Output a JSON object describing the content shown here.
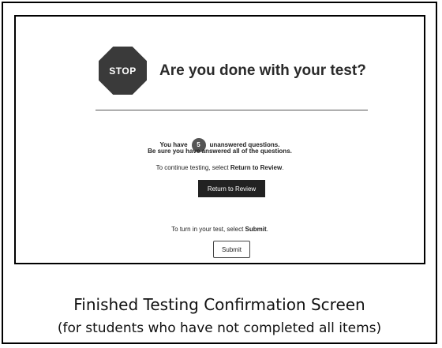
{
  "dialog": {
    "stop_label": "STOP",
    "title": "Are you done with your test?",
    "unanswered": {
      "prefix": "You have",
      "count": "5",
      "suffix": "unanswered questions."
    },
    "reminder": "Be sure you have answered all of the questions.",
    "continue_text": {
      "prefix": "To continue testing, select ",
      "action": "Return to Review",
      "suffix": "."
    },
    "review_button_label": "Return to Review",
    "submit_text": {
      "prefix": "To turn in your test, select ",
      "action": "Submit",
      "suffix": "."
    },
    "submit_button_label": "Submit"
  },
  "caption": {
    "line1": "Finished Testing Confirmation Screen",
    "line2": "(for students who have not completed all items)"
  },
  "colors": {
    "stop_sign": "#3a3a3a",
    "badge": "#555555",
    "primary_button": "#222222"
  }
}
